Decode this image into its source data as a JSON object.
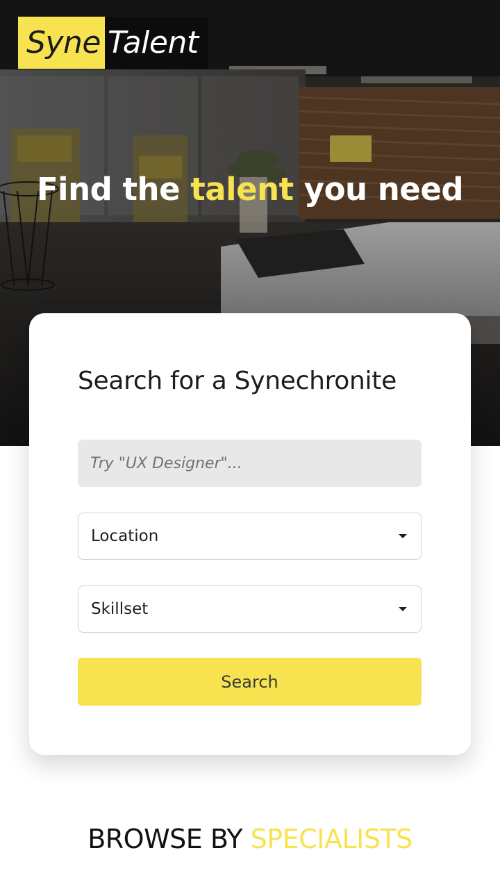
{
  "brand": {
    "logo_part1": "Syne",
    "logo_part2": "Talent",
    "accent_color": "#f7e34f"
  },
  "hero": {
    "title_before": "Find the ",
    "title_accent": "talent",
    "title_after": " you need"
  },
  "search_card": {
    "title": "Search for a Synechronite",
    "keyword_placeholder": "Try \"UX Designer\"...",
    "location_label": "Location",
    "skillset_label": "Skillset",
    "search_button_label": "Search"
  },
  "browse": {
    "prefix": "BROWSE BY ",
    "accent": "SPECIALISTS"
  }
}
